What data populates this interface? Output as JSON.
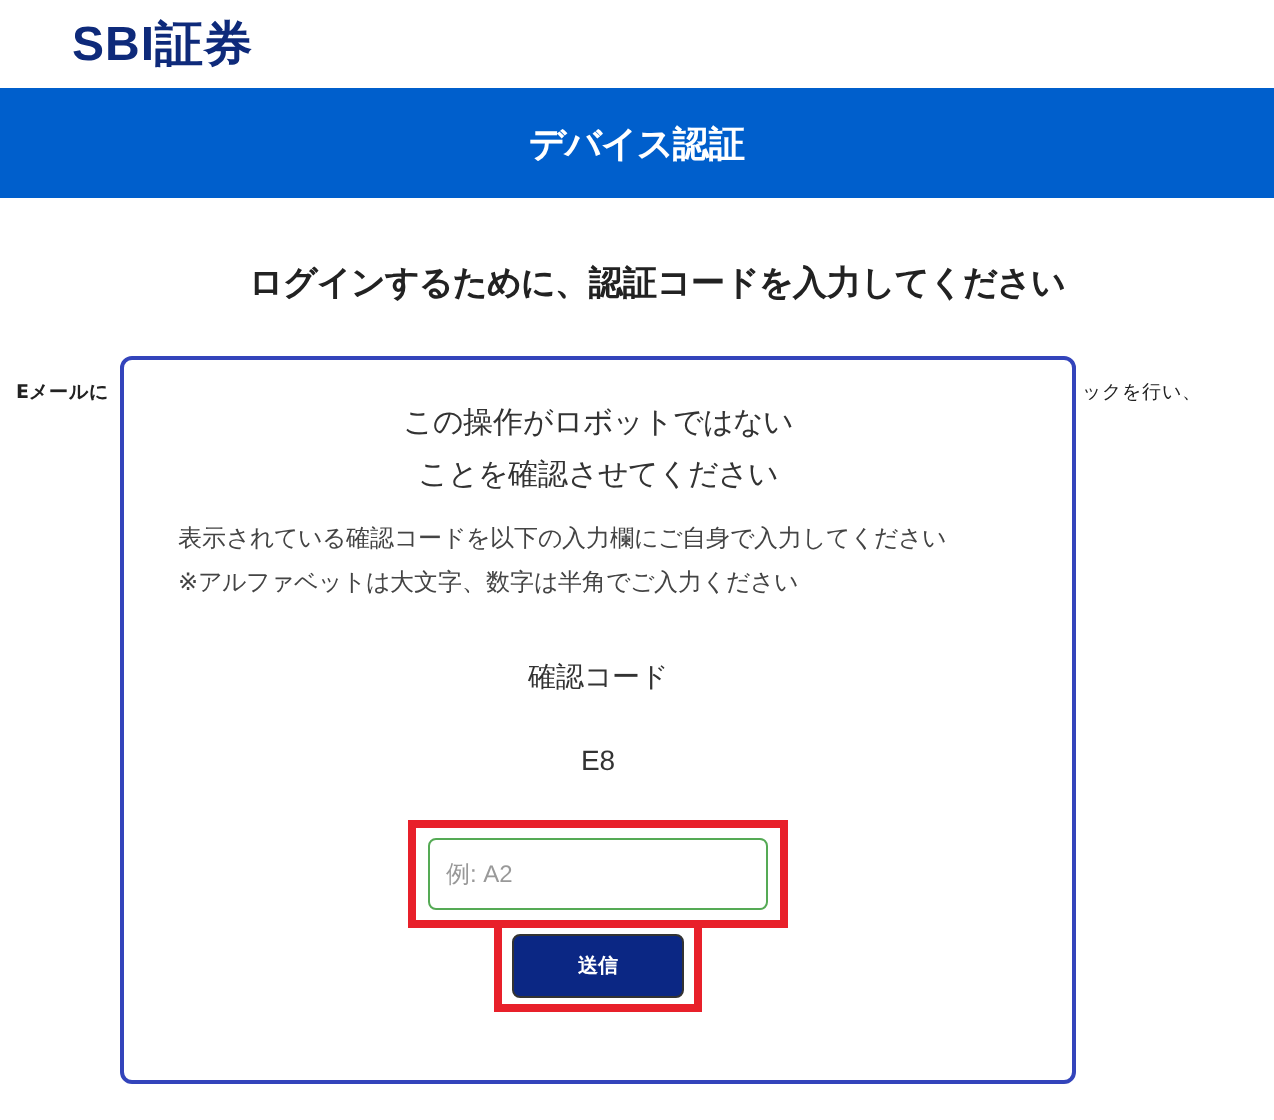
{
  "logo": {
    "text": "SBI証券"
  },
  "banner": {
    "title": "デバイス認証"
  },
  "heading": "ログインするために、認証コードを入力してください",
  "background_text": {
    "left": "Eメールに",
    "right": "ックを行い、"
  },
  "dialog": {
    "title_lines": [
      "この操作がロボットではない",
      "ことを確認させてください"
    ],
    "instructions": [
      "表示されている確認コードを以下の入力欄にご自身で入力してください",
      "※アルファベットは大文字、数字は半角でご入力ください"
    ],
    "code_label": "確認コード",
    "code": "E8",
    "input": {
      "placeholder": "例: A2",
      "highlighted": true
    },
    "submit": {
      "label": "送信",
      "highlighted": true
    }
  }
}
